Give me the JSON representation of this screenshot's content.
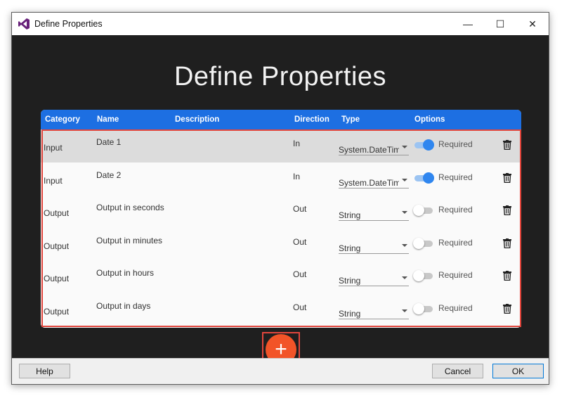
{
  "window": {
    "title": "Define Properties",
    "controls": {
      "minimize": "—",
      "maximize": "☐",
      "close": "✕"
    }
  },
  "page_title": "Define Properties",
  "table": {
    "headers": [
      "Category",
      "Name",
      "Description",
      "Direction",
      "Type",
      "Options"
    ],
    "rows": [
      {
        "category": "Input",
        "name": "Date 1",
        "direction": "In",
        "type": "System.DateTim",
        "required_label": "Required",
        "required": true,
        "selected": true
      },
      {
        "category": "Input",
        "name": "Date 2",
        "direction": "In",
        "type": "System.DateTim",
        "required_label": "Required",
        "required": true,
        "selected": false
      },
      {
        "category": "Output",
        "name": "Output in seconds",
        "direction": "Out",
        "type": "String",
        "required_label": "Required",
        "required": false,
        "selected": false
      },
      {
        "category": "Output",
        "name": "Output in minutes",
        "direction": "Out",
        "type": "String",
        "required_label": "Required",
        "required": false,
        "selected": false
      },
      {
        "category": "Output",
        "name": "Output in hours",
        "direction": "Out",
        "type": "String",
        "required_label": "Required",
        "required": false,
        "selected": false
      },
      {
        "category": "Output",
        "name": "Output in days",
        "direction": "Out",
        "type": "String",
        "required_label": "Required",
        "required": false,
        "selected": false
      }
    ]
  },
  "add_button": {
    "label": "+"
  },
  "footer": {
    "help": "Help",
    "cancel": "Cancel",
    "ok": "OK"
  },
  "colors": {
    "header": "#1d6fe2",
    "accent_add": "#f25428",
    "highlight": "#e2463d",
    "toggle_on": "#2f86ef"
  }
}
